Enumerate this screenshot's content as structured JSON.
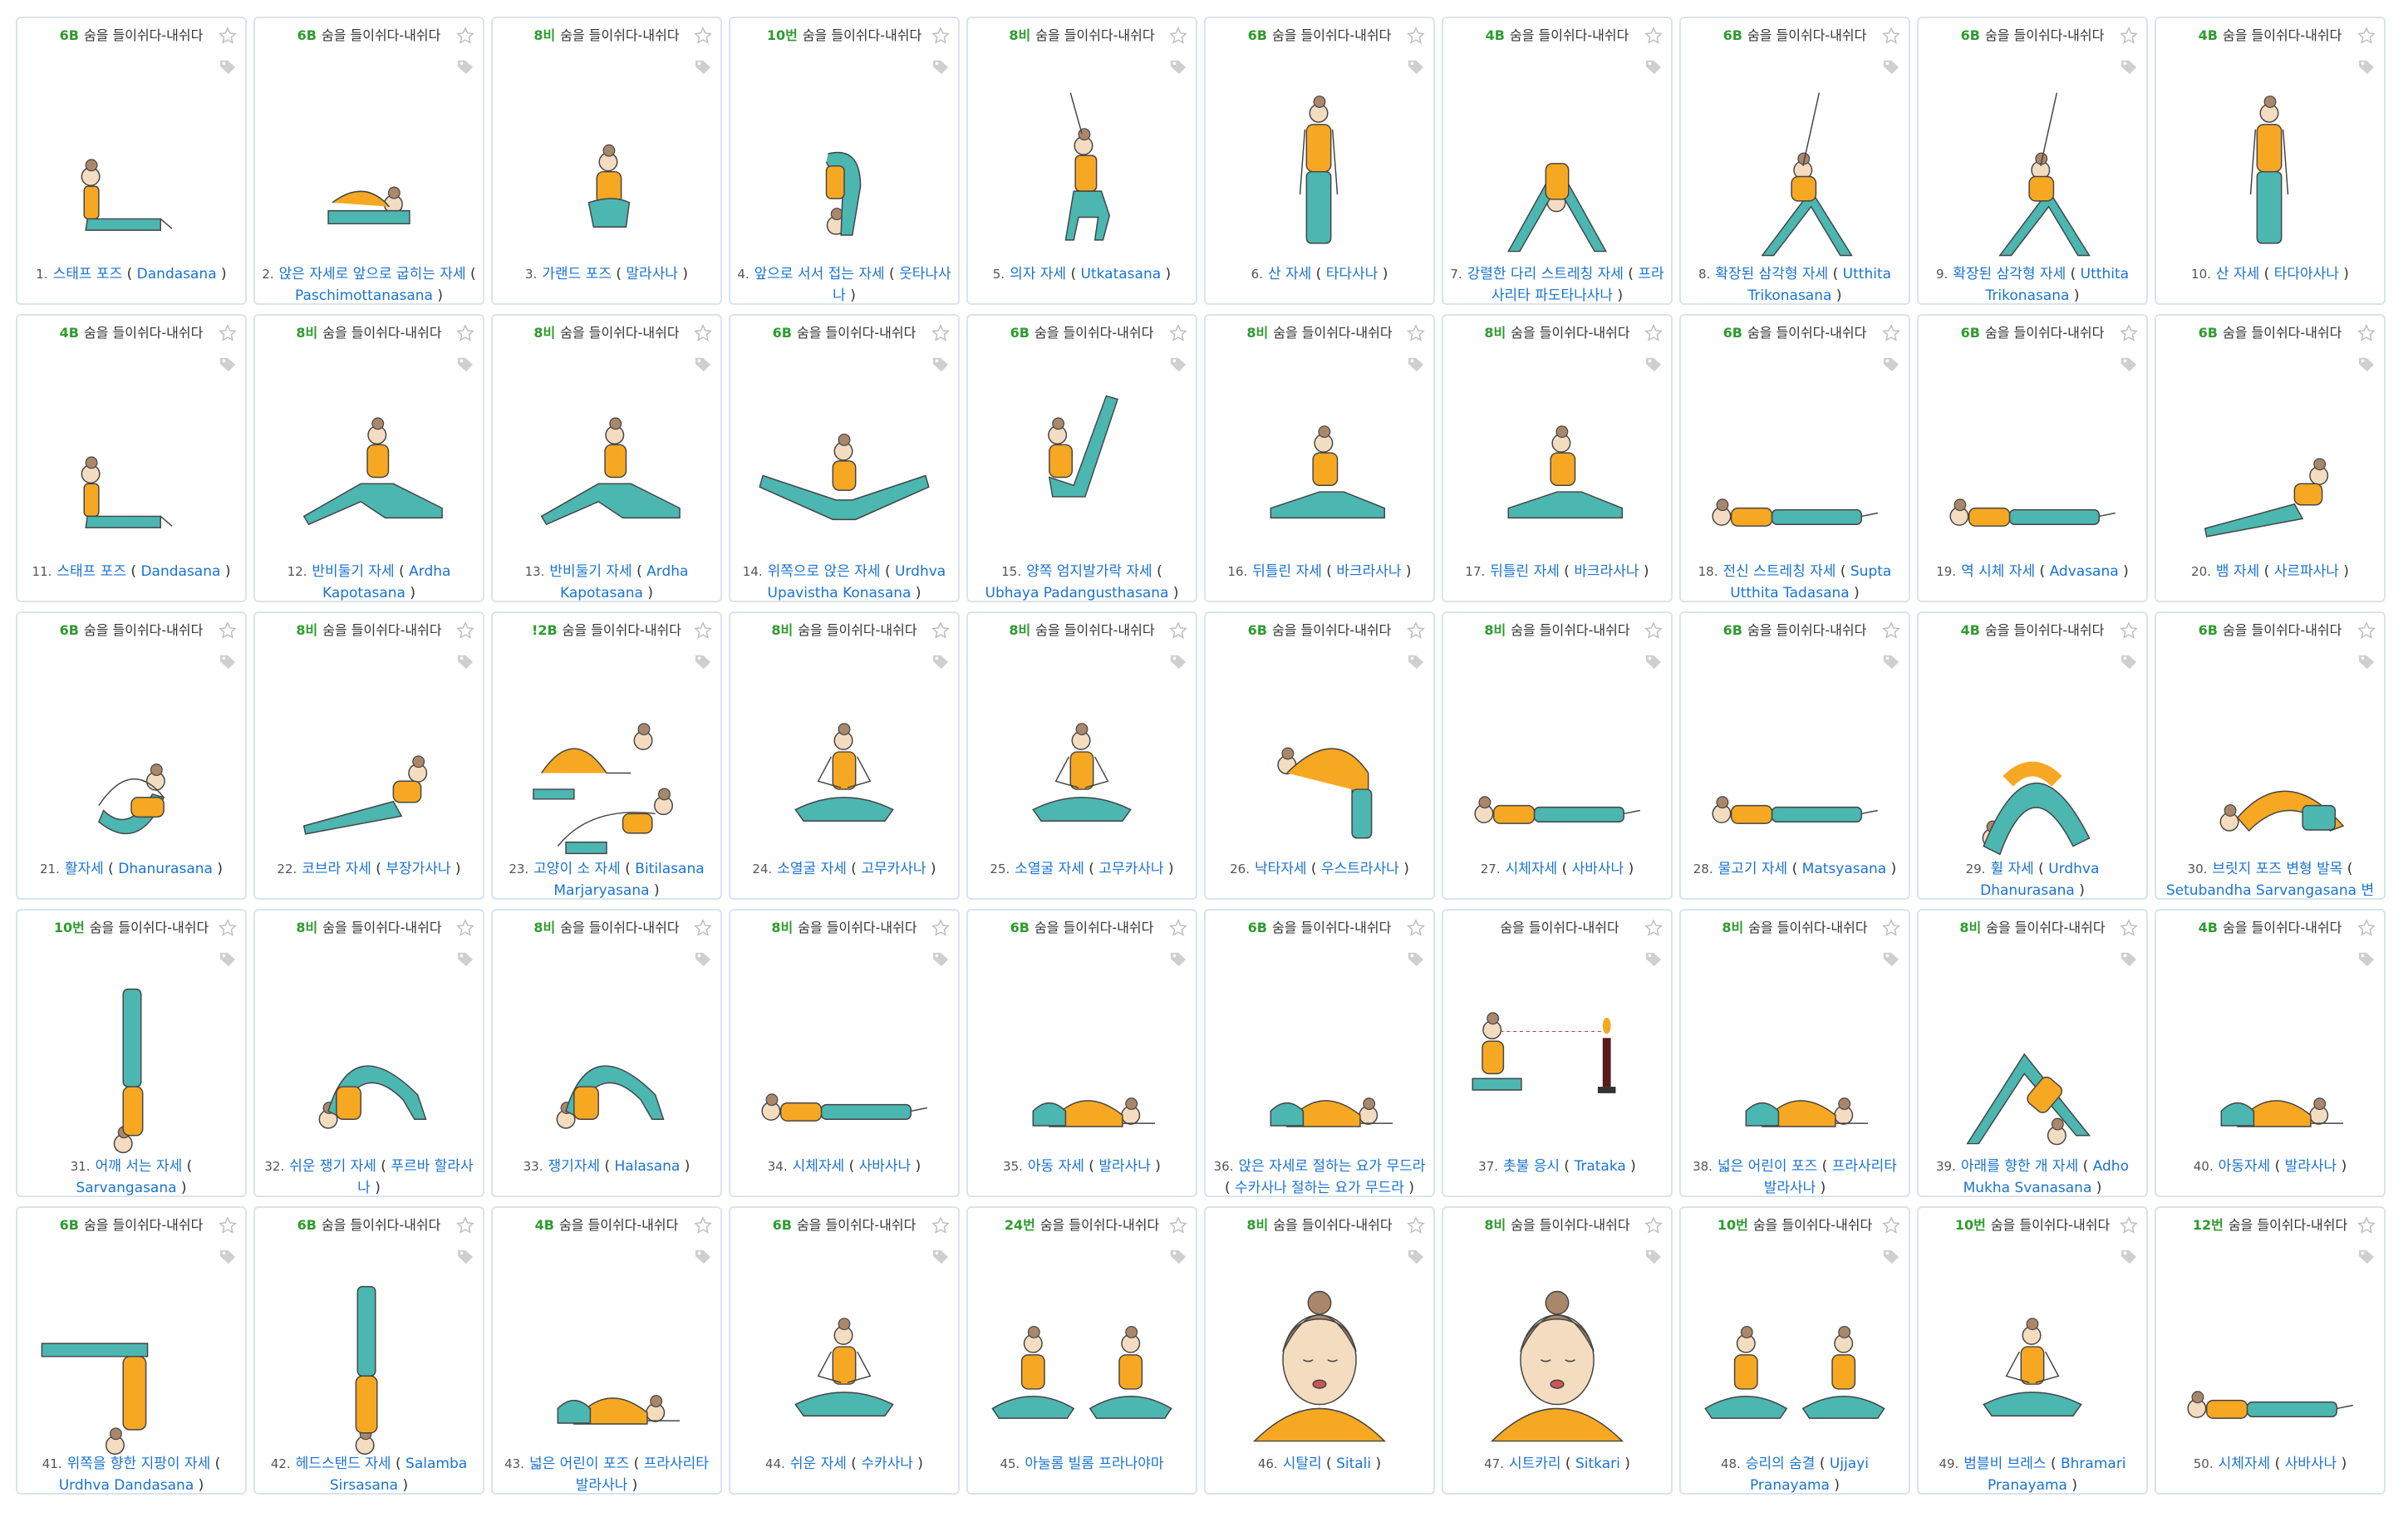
{
  "card_header_text": "숨을 들이쉬다-내쉬다",
  "colors": {
    "count": "#2e9b2e",
    "link": "#1a73d1",
    "border": "#d9e4ec",
    "skin": "#f4dcc0",
    "top": "#f7a823",
    "pants": "#4cb6b1",
    "hair": "#a9876a"
  },
  "icons": {
    "favorite": "star-icon",
    "tag": "tag-icon"
  },
  "poses": [
    {
      "no": "1.",
      "count": "6B",
      "name": "스태프 포즈",
      "sans": "Dandasana",
      "fig": "sit"
    },
    {
      "no": "2.",
      "count": "6B",
      "name": "앉은 자세로 앞으로 굽히는 자세",
      "sans": "Paschimottanasana",
      "fig": "fold"
    },
    {
      "no": "3.",
      "count": "8비",
      "name": "가랜드 포즈",
      "sans": "말라사나",
      "fig": "squat"
    },
    {
      "no": "4.",
      "count": "10번",
      "name": "앞으로 서서 접는 자세",
      "sans": "웃타나사나",
      "fig": "standfold"
    },
    {
      "no": "5.",
      "count": "8비",
      "name": "의자 자세",
      "sans": "Utkatasana",
      "fig": "chair"
    },
    {
      "no": "6.",
      "count": "6B",
      "name": "산 자세",
      "sans": "타다사나",
      "fig": "stand"
    },
    {
      "no": "7.",
      "count": "4B",
      "name": "강렬한 다리 스트레칭 자세",
      "sans": "프라사리타 파도타나사나",
      "fig": "wide"
    },
    {
      "no": "8.",
      "count": "6B",
      "name": "확장된 삼각형 자세",
      "sans": "Utthita Trikonasana",
      "fig": "triangle"
    },
    {
      "no": "9.",
      "count": "6B",
      "name": "확장된 삼각형 자세",
      "sans": "Utthita Trikonasana",
      "fig": "triangle"
    },
    {
      "no": "10.",
      "count": "4B",
      "name": "산 자세",
      "sans": "타다아사나",
      "fig": "stand"
    },
    {
      "no": "11.",
      "count": "4B",
      "name": "스태프 포즈",
      "sans": "Dandasana",
      "fig": "sit"
    },
    {
      "no": "12.",
      "count": "8비",
      "name": "반비둘기 자세",
      "sans": "Ardha Kapotasana",
      "fig": "pigeon"
    },
    {
      "no": "13.",
      "count": "8비",
      "name": "반비둘기 자세",
      "sans": "Ardha Kapotasana",
      "fig": "pigeon"
    },
    {
      "no": "14.",
      "count": "6B",
      "name": "위쪽으로 앉은 자세",
      "sans": "Urdhva Upavistha Konasana",
      "fig": "vsit"
    },
    {
      "no": "15.",
      "count": "6B",
      "name": "양쪽 엄지발가락 자세",
      "sans": "Ubhaya Padangusthasana",
      "fig": "boat"
    },
    {
      "no": "16.",
      "count": "8비",
      "name": "뒤틀린 자세",
      "sans": "바크라사나",
      "fig": "twist"
    },
    {
      "no": "17.",
      "count": "8비",
      "name": "뒤틀린 자세",
      "sans": "바크라사나",
      "fig": "twist"
    },
    {
      "no": "18.",
      "count": "6B",
      "name": "전신 스트레칭 자세",
      "sans": "Supta Utthita Tadasana",
      "fig": "lie"
    },
    {
      "no": "19.",
      "count": "6B",
      "name": "역 시체 자세",
      "sans": "Advasana",
      "fig": "lie"
    },
    {
      "no": "20.",
      "count": "6B",
      "name": "뱀 자세",
      "sans": "사르파사나",
      "fig": "cobra"
    },
    {
      "no": "21.",
      "count": "6B",
      "name": "활자세",
      "sans": "Dhanurasana",
      "fig": "bow"
    },
    {
      "no": "22.",
      "count": "8비",
      "name": "코브라 자세",
      "sans": "부장가사나",
      "fig": "cobra"
    },
    {
      "no": "23.",
      "count": "!2B",
      "name": "고양이 소 자세",
      "sans": "Bitilasana Marjaryasana",
      "fig": "catcow"
    },
    {
      "no": "24.",
      "count": "8비",
      "name": "소열굴 자세",
      "sans": "고무카사나",
      "fig": "meditate"
    },
    {
      "no": "25.",
      "count": "8비",
      "name": "소열굴 자세",
      "sans": "고무카사나",
      "fig": "meditate"
    },
    {
      "no": "26.",
      "count": "6B",
      "name": "낙타자세",
      "sans": "우스트라사나",
      "fig": "camel"
    },
    {
      "no": "27.",
      "count": "8비",
      "name": "시체자세",
      "sans": "사바사나",
      "fig": "lie"
    },
    {
      "no": "28.",
      "count": "6B",
      "name": "물고기 자세",
      "sans": "Matsyasana",
      "fig": "lie"
    },
    {
      "no": "29.",
      "count": "4B",
      "name": "휠 자세",
      "sans": "Urdhva Dhanurasana",
      "fig": "wheel"
    },
    {
      "no": "30.",
      "count": "6B",
      "name": "브릿지 포즈 변형 발목",
      "sans": "Setubandha Sarvangasana 변형 발",
      "fig": "bridge"
    },
    {
      "no": "31.",
      "count": "10번",
      "name": "어깨 서는 자세",
      "sans": "Sarvangasana",
      "fig": "shoulderstand"
    },
    {
      "no": "32.",
      "count": "8비",
      "name": "쉬운 쟁기 자세",
      "sans": "푸르바 할라사나",
      "fig": "plow"
    },
    {
      "no": "33.",
      "count": "8비",
      "name": "쟁기자세",
      "sans": "Halasana",
      "fig": "plow"
    },
    {
      "no": "34.",
      "count": "8비",
      "name": "시체자세",
      "sans": "사바사나",
      "fig": "lie"
    },
    {
      "no": "35.",
      "count": "6B",
      "name": "아동 자세",
      "sans": "발라사나",
      "fig": "child"
    },
    {
      "no": "36.",
      "count": "6B",
      "name": "앉은 자세로 절하는 요가 무드라",
      "sans": "수카사나 절하는 요가 무드라",
      "fig": "child"
    },
    {
      "no": "37.",
      "count": "",
      "name": "촛불 응시",
      "sans": "Trataka",
      "fig": "candle"
    },
    {
      "no": "38.",
      "count": "8비",
      "name": "넓은 어린이 포즈",
      "sans": "프라사리타 발라사나",
      "fig": "child"
    },
    {
      "no": "39.",
      "count": "8비",
      "name": "아래를 향한 개 자세",
      "sans": "Adho Mukha Svanasana",
      "fig": "dog"
    },
    {
      "no": "40.",
      "count": "4B",
      "name": "아동자세",
      "sans": "발라사나",
      "fig": "child"
    },
    {
      "no": "41.",
      "count": "6B",
      "name": "위쪽을 향한 지팡이 자세",
      "sans": "Urdhva Dandasana",
      "fig": "halfhead"
    },
    {
      "no": "42.",
      "count": "6B",
      "name": "헤드스탠드 자세",
      "sans": "Salamba Sirsasana",
      "fig": "headstand"
    },
    {
      "no": "43.",
      "count": "4B",
      "name": "넓은 어린이 포즈",
      "sans": "프라사리타 발라사나",
      "fig": "child"
    },
    {
      "no": "44.",
      "count": "6B",
      "name": "쉬운 자세",
      "sans": "수카사나",
      "fig": "meditate"
    },
    {
      "no": "45.",
      "count": "24번",
      "name": "아눌롬 빌롬 프라나야마",
      "sans": "",
      "fig": "twomed"
    },
    {
      "no": "46.",
      "count": "8비",
      "name": "시탈리",
      "sans": "Sitali",
      "fig": "face"
    },
    {
      "no": "47.",
      "count": "8비",
      "name": "시트카리",
      "sans": "Sitkari",
      "fig": "face"
    },
    {
      "no": "48.",
      "count": "10번",
      "name": "승리의 숨결",
      "sans": "Ujjayi Pranayama",
      "fig": "twomed"
    },
    {
      "no": "49.",
      "count": "10번",
      "name": "범블비 브레스",
      "sans": "Bhramari Pranayama",
      "fig": "meditate"
    },
    {
      "no": "50.",
      "count": "12번",
      "name": "시체자세",
      "sans": "사바사나",
      "fig": "lie"
    }
  ]
}
